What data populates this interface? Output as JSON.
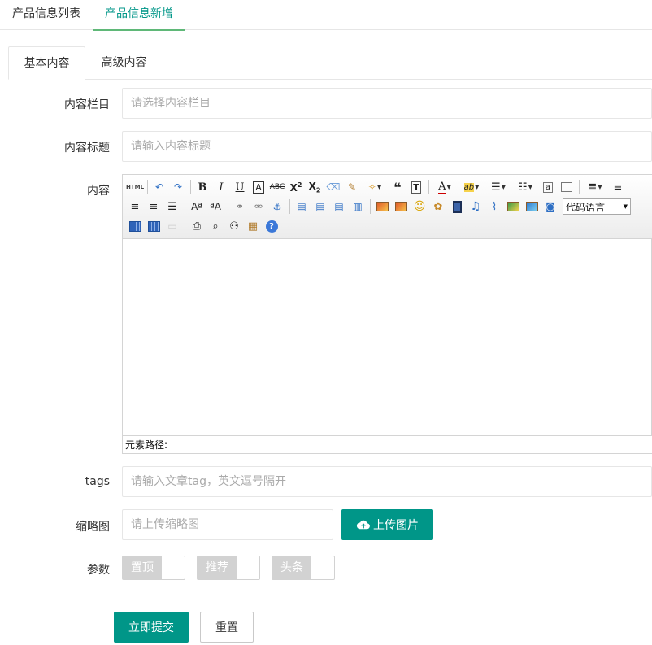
{
  "top_tabs": [
    {
      "label": "产品信息列表",
      "active": false
    },
    {
      "label": "产品信息新增",
      "active": true
    }
  ],
  "inner_tabs": [
    {
      "label": "基本内容",
      "active": true
    },
    {
      "label": "高级内容",
      "active": false
    }
  ],
  "form": {
    "category": {
      "label": "内容栏目",
      "placeholder": "请选择内容栏目",
      "value": ""
    },
    "title": {
      "label": "内容标题",
      "placeholder": "请输入内容标题",
      "value": ""
    },
    "content": {
      "label": "内容"
    },
    "tags": {
      "label": "tags",
      "placeholder": "请输入文章tag，英文逗号隔开",
      "value": ""
    },
    "thumbnail": {
      "label": "缩略图",
      "placeholder": "请上传缩略图",
      "value": "",
      "upload_label": "上传图片"
    },
    "params": {
      "label": "参数",
      "switches": [
        {
          "label": "置顶",
          "on": false
        },
        {
          "label": "推荐",
          "on": false
        },
        {
          "label": "头条",
          "on": false
        }
      ]
    },
    "submit_label": "立即提交",
    "reset_label": "重置"
  },
  "editor": {
    "code_language_select": "代码语言",
    "status_path_label": "元素路径:",
    "html_button": "HTML",
    "help_glyph": "?"
  },
  "colors": {
    "primary": "#009688",
    "active_tab_underline": "#5fb878",
    "switch_off": "#d2d2d2"
  }
}
